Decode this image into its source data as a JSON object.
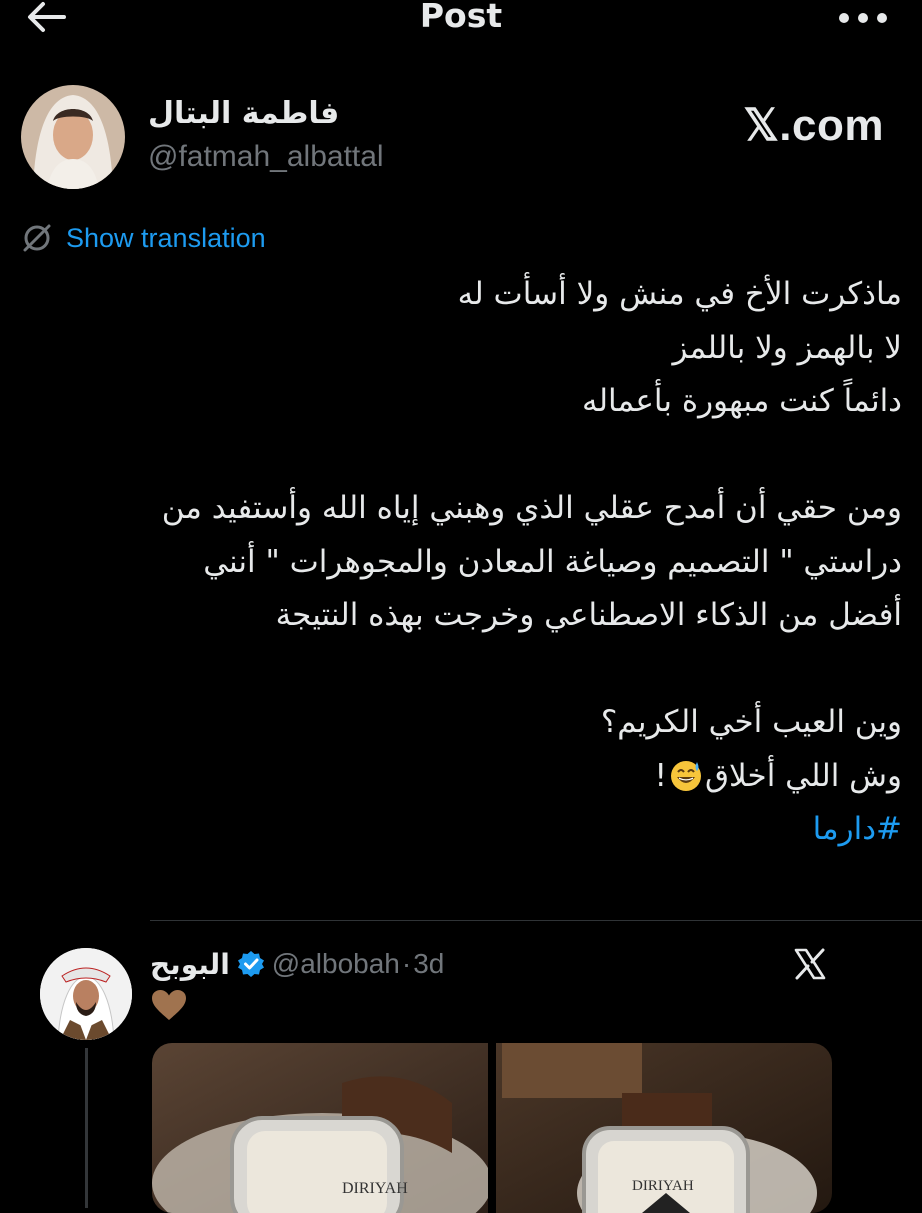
{
  "header": {
    "title": "Post",
    "back_icon": "arrow-left-icon",
    "more_icon": "more-dots-icon"
  },
  "author": {
    "name": "فاطمة البتال",
    "handle": "@fatmah_albattal"
  },
  "watermark": "𝕏.com",
  "translation": {
    "label": "Show translation",
    "icon": "translate-icon"
  },
  "tweet": {
    "lines": [
      "ماذكرت الأخ في منش ولا أسأت له",
      "لا بالهمز ولا باللمز",
      "دائماً كنت مبهورة بأعماله",
      "",
      "ومن حقي أن أمدح عقلي الذي وهبني إياه الله وأستفيد من",
      "دراستي \" التصميم وصياغة المعادن والمجوهرات \" أنني",
      "أفضل من الذكاء الاصطناعي وخرجت بهذه النتيجة",
      "",
      "وين العيب أخي الكريم؟",
      "وش اللي أخلاق"
    ],
    "emoji_suffix": "!",
    "emoji": "grinning-sweat-emoji",
    "hashtag": "#دارما"
  },
  "quoted": {
    "name": "البوبح",
    "handle": "@albobah",
    "separator": "·",
    "time": "3d",
    "heart_emoji": "brown-heart-emoji",
    "x_icon": "x-logo-icon",
    "watch_brand": "DIRIYAH"
  },
  "colors": {
    "background": "#000000",
    "text": "#e7e9ea",
    "muted": "#71767b",
    "accent": "#1d9bf0"
  }
}
